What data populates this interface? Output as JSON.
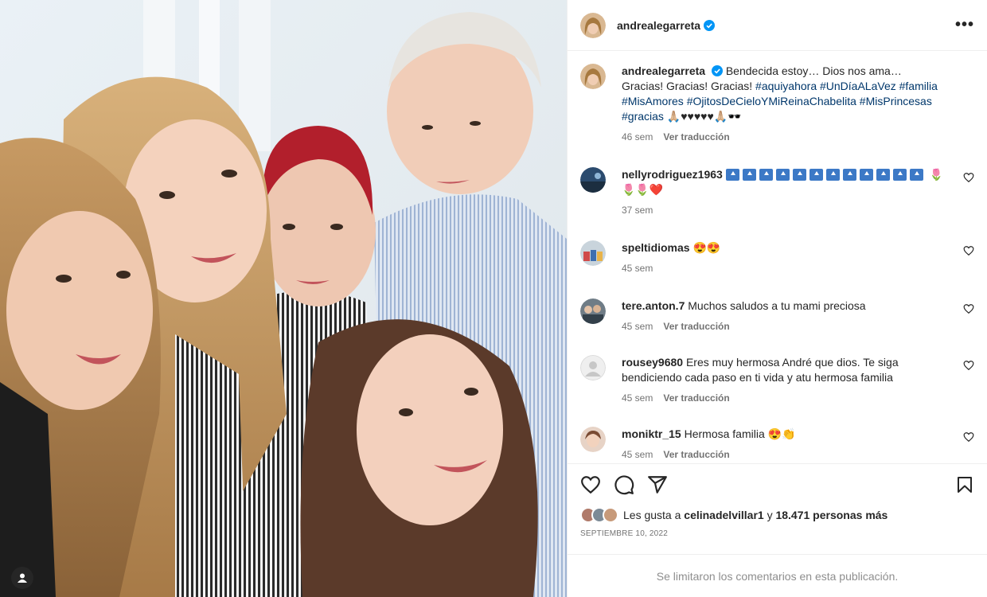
{
  "post_author": "andrealegarreta",
  "more_label": "•••",
  "caption": {
    "user": "andrealegarreta",
    "text_1": "Bendecida estoy… Dios nos ama…",
    "text_2": "Gracias! Gracias! Gracias!",
    "tags": [
      "#aquiyahora",
      "#UnDíaALaVez",
      "#familia",
      "#MisAmores",
      "#OjitosDeCieloYMiReinaChabelita",
      "#MisPrincesas",
      "#gracias"
    ],
    "emojis": "🙏🏼♥♥♥♥♥🙏🏼🕶️",
    "age": "46 sem",
    "translate": "Ver traducción"
  },
  "comments": [
    {
      "user": "nellyrodriguez1963",
      "text": "🌷🌷🌷❤️",
      "age": "37 sem",
      "translate": ""
    },
    {
      "user": "speltidiomas",
      "text": "😍😍",
      "age": "45 sem",
      "translate": ""
    },
    {
      "user": "tere.anton.7",
      "text": "Muchos saludos a tu mami preciosa",
      "age": "45 sem",
      "translate": "Ver traducción"
    },
    {
      "user": "rousey9680",
      "text": "Eres muy hermosa André que dios. Te siga bendiciendo cada paso en ti vida y atu hermosa familia",
      "age": "45 sem",
      "translate": "Ver traducción"
    },
    {
      "user": "moniktr_15",
      "text": "Hermosa familia 😍👏",
      "age": "45 sem",
      "translate": "Ver traducción"
    }
  ],
  "likes": {
    "prefix": "Les gusta a",
    "user": "celinadelvillar1",
    "joiner": "y",
    "count": "18.471 personas más"
  },
  "date": "SEPTIEMBRE 10, 2022",
  "limited": "Se limitaron los comentarios en esta publicación.",
  "colors": {
    "link": "#00376b",
    "verified": "#0095f6",
    "muted": "#737373"
  }
}
